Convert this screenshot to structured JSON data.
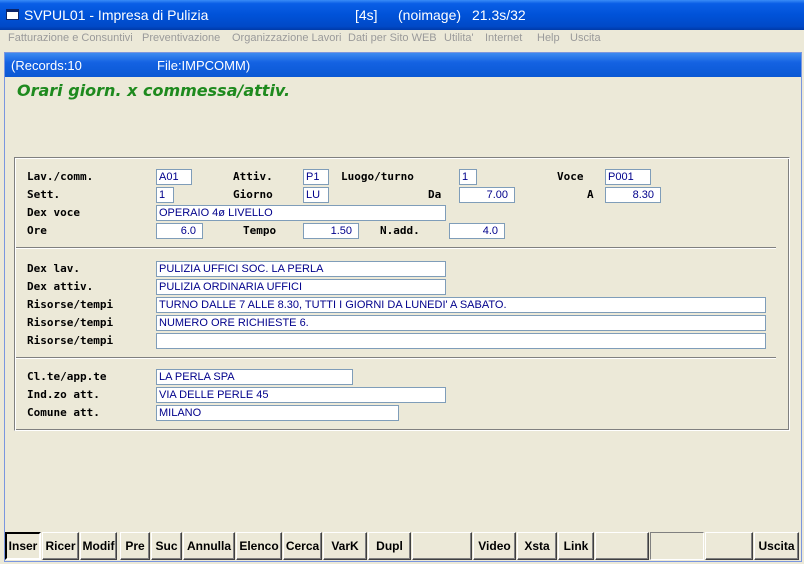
{
  "titlebar": {
    "app": "SVPUL01 - Impresa di Pulizia",
    "code": "[4s]",
    "image": "(noimage)",
    "time": "21.3s/32"
  },
  "menu": [
    "Fatturazione e Consuntivi",
    "Preventivazione",
    "Organizzazione Lavori",
    "Dati per Sito WEB",
    "Utilita'",
    "Internet",
    "Help",
    "Uscita"
  ],
  "status": {
    "records": "(Records:10",
    "file": "File:IMPCOMM)"
  },
  "form_title": "Orari giorn. x commessa/attiv.",
  "labels": {
    "lav_comm": "Lav./comm.",
    "attiv": "Attiv.",
    "luogo_turno": "Luogo/turno",
    "voce": "Voce",
    "sett": "Sett.",
    "giorno": "Giorno",
    "da": "Da",
    "a": "A",
    "dex_voce": "Dex voce",
    "ore": "Ore",
    "tempo": "Tempo",
    "n_add": "N.add.",
    "dex_lav": "Dex lav.",
    "dex_attiv": "Dex attiv.",
    "risorse": "Risorse/tempi",
    "cliente": "Cl.te/app.te",
    "indirizzo": "Ind.zo att.",
    "comune": "Comune att."
  },
  "fields": {
    "lav_comm": "A01",
    "attiv": "P1",
    "luogo_turno": "1",
    "voce": "P001",
    "sett": "1",
    "giorno": "LU",
    "da": "7.00",
    "a": "8.30",
    "dex_voce": "OPERAIO 4ø LIVELLO",
    "ore": "6.0",
    "tempo": "1.50",
    "n_add": "4.0",
    "dex_lav": "PULIZIA UFFICI SOC. LA PERLA",
    "dex_attiv": "PULIZIA ORDINARIA UFFICI",
    "risorse_1": "TURNO DALLE 7 ALLE 8.30, TUTTI I GIORNI DA LUNEDI' A SABATO.",
    "risorse_2": "NUMERO ORE RICHIESTE 6.",
    "risorse_3": "",
    "cliente": "LA PERLA SPA",
    "indirizzo": "VIA DELLE PERLE 45",
    "comune": "MILANO"
  },
  "buttons": {
    "inser": "Inser",
    "ricer": "Ricer",
    "modif": "Modif",
    "pre": "Pre",
    "suc": "Suc",
    "annulla": "Annulla",
    "elenco": "Elenco",
    "cerca": "Cerca",
    "vark": "VarK",
    "dupl": "Dupl",
    "video": "Video",
    "xsta": "Xsta",
    "link": "Link",
    "uscita": "Uscita"
  }
}
